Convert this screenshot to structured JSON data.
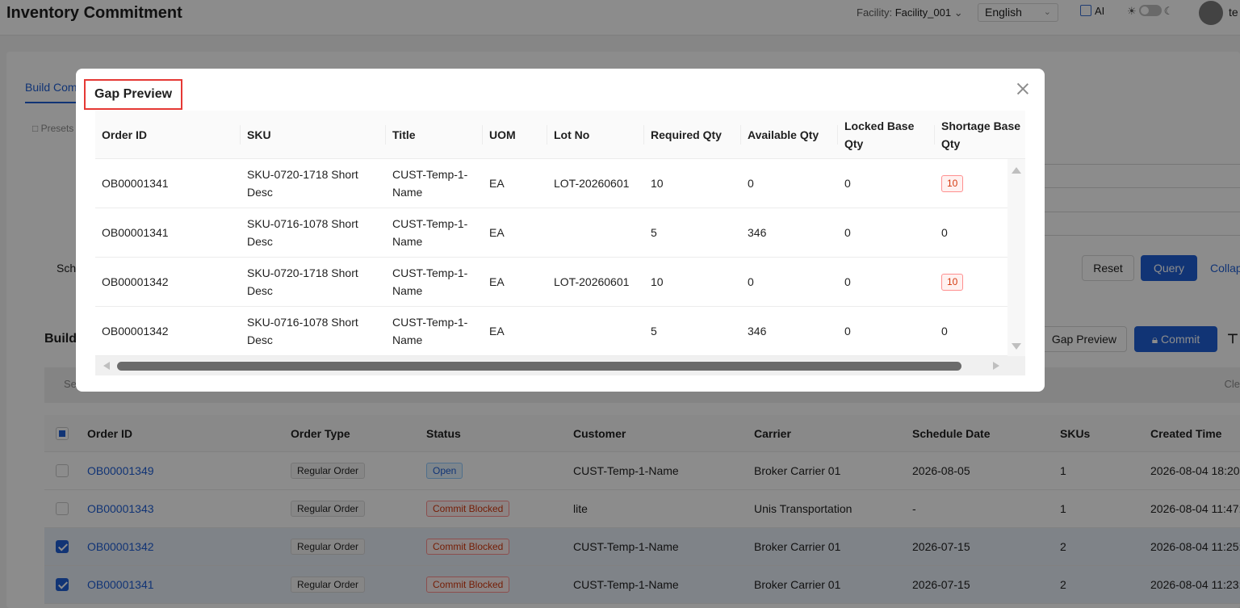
{
  "header": {
    "title": "Inventory Commitment",
    "facility_label": "Facility:",
    "facility_value": "Facility_001",
    "language": "English",
    "ai_label": "AI",
    "user_initial": "te"
  },
  "page": {
    "tab_label": "Build Com",
    "presets_label": "Presets",
    "schedule_label": "Sche",
    "reset_label": "Reset",
    "query_label": "Query",
    "collapse_label": "Collap",
    "build_label": "Build",
    "gap_preview_btn": "Gap Preview",
    "commit_btn": "Commit",
    "filter_left": "Se",
    "filter_right": "Cle"
  },
  "orders_table": {
    "columns": [
      "Order ID",
      "Order Type",
      "Status",
      "Customer",
      "Carrier",
      "Schedule Date",
      "SKUs",
      "Created Time"
    ],
    "rows": [
      {
        "checked": false,
        "order_id": "OB00001349",
        "order_type": "Regular Order",
        "status": "Open",
        "status_kind": "open",
        "customer": "CUST-Temp-1-Name",
        "carrier": "Broker Carrier 01",
        "schedule_date": "2026-08-05",
        "skus": "1",
        "created": "2026-08-04 18:20:"
      },
      {
        "checked": false,
        "order_id": "OB00001343",
        "order_type": "Regular Order",
        "status": "Commit Blocked",
        "status_kind": "blocked",
        "customer": "lite",
        "carrier": "Unis Transportation",
        "schedule_date": "-",
        "skus": "1",
        "created": "2026-08-04 11:47:"
      },
      {
        "checked": true,
        "order_id": "OB00001342",
        "order_type": "Regular Order",
        "status": "Commit Blocked",
        "status_kind": "blocked",
        "customer": "CUST-Temp-1-Name",
        "carrier": "Broker Carrier 01",
        "schedule_date": "2026-07-15",
        "skus": "2",
        "created": "2026-08-04 11:25:"
      },
      {
        "checked": true,
        "order_id": "OB00001341",
        "order_type": "Regular Order",
        "status": "Commit Blocked",
        "status_kind": "blocked",
        "customer": "CUST-Temp-1-Name",
        "carrier": "Broker Carrier 01",
        "schedule_date": "2026-07-15",
        "skus": "2",
        "created": "2026-08-04 11:23:"
      }
    ]
  },
  "modal": {
    "title": "Gap Preview",
    "columns": [
      "Order ID",
      "SKU",
      "Title",
      "UOM",
      "Lot No",
      "Required Qty",
      "Available Qty",
      "Locked Base Qty",
      "Shortage Base Qty"
    ],
    "rows": [
      {
        "order_id": "OB00001341",
        "sku": "SKU-0720-1718 Short Desc",
        "title": "CUST-Temp-1-Name",
        "uom": "EA",
        "lot_no": "LOT-20260601",
        "required": "10",
        "available": "0",
        "locked": "0",
        "shortage": "10",
        "shortage_flag": true
      },
      {
        "order_id": "OB00001341",
        "sku": "SKU-0716-1078 Short Desc",
        "title": "CUST-Temp-1-Name",
        "uom": "EA",
        "lot_no": "",
        "required": "5",
        "available": "346",
        "locked": "0",
        "shortage": "0",
        "shortage_flag": false
      },
      {
        "order_id": "OB00001342",
        "sku": "SKU-0720-1718 Short Desc",
        "title": "CUST-Temp-1-Name",
        "uom": "EA",
        "lot_no": "LOT-20260601",
        "required": "10",
        "available": "0",
        "locked": "0",
        "shortage": "10",
        "shortage_flag": true
      },
      {
        "order_id": "OB00001342",
        "sku": "SKU-0716-1078 Short Desc",
        "title": "CUST-Temp-1-Name",
        "uom": "EA",
        "lot_no": "",
        "required": "5",
        "available": "346",
        "locked": "0",
        "shortage": "0",
        "shortage_flag": false
      }
    ]
  },
  "colors": {
    "primary": "#1f5fd6",
    "highlight_border": "#e53935",
    "danger": "#d4380d",
    "selected_row": "#e8eef8"
  }
}
